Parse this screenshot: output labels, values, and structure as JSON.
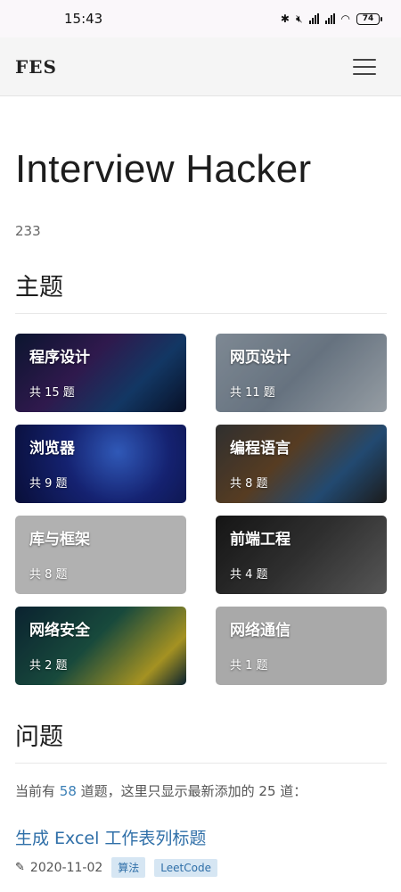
{
  "status_bar": {
    "time": "15:43",
    "battery": "74"
  },
  "navbar": {
    "brand": "FES"
  },
  "site": {
    "title": "Interview Hacker",
    "subtitle": "233"
  },
  "topics": {
    "title": "主题",
    "items": [
      {
        "name": "程序设计",
        "count": "共 15 题"
      },
      {
        "name": "网页设计",
        "count": "共 11 题"
      },
      {
        "name": "浏览器",
        "count": "共 9 题"
      },
      {
        "name": "编程语言",
        "count": "共 8 题"
      },
      {
        "name": "库与框架",
        "count": "共 8 题"
      },
      {
        "name": "前端工程",
        "count": "共 4 题"
      },
      {
        "name": "网络安全",
        "count": "共 2 题"
      },
      {
        "name": "网络通信",
        "count": "共 1 题"
      }
    ]
  },
  "questions": {
    "title": "问题",
    "intro_prefix": "当前有 ",
    "total": "58",
    "intro_suffix": " 道题，这里只显示最新添加的 25 道：",
    "latest": {
      "title": "生成 Excel 工作表列标题",
      "date": "2020-11-02",
      "tags": [
        "算法",
        "LeetCode"
      ]
    }
  },
  "colors": {
    "link": "#2f6fa8",
    "tag_bg": "#d6e6f3"
  }
}
